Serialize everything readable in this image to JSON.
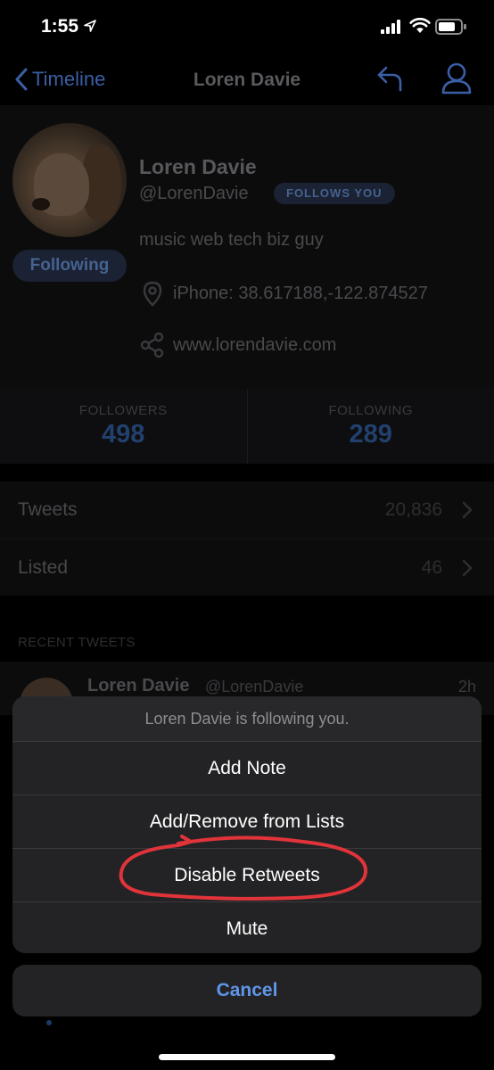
{
  "status_bar": {
    "time": "1:55"
  },
  "nav": {
    "back_label": "Timeline",
    "title": "Loren Davie"
  },
  "profile": {
    "name": "Loren Davie",
    "handle": "@LorenDavie",
    "follows_badge": "FOLLOWS YOU",
    "following_button": "Following",
    "bio": "music web tech biz guy",
    "location": "iPhone: 38.617188,-122.874527",
    "website": "www.lorendavie.com"
  },
  "stats": {
    "followers_label": "FOLLOWERS",
    "followers_count": "498",
    "following_label": "FOLLOWING",
    "following_count": "289"
  },
  "list": [
    {
      "label": "Tweets",
      "value": "20,836"
    },
    {
      "label": "Listed",
      "value": "46"
    }
  ],
  "recent_tweets": {
    "header": "RECENT TWEETS",
    "tweet": {
      "name": "Loren Davie",
      "handle": "@LorenDavie",
      "time": "2h"
    }
  },
  "action_sheet": {
    "message": "Loren Davie is following you.",
    "actions": [
      "Add Note",
      "Add/Remove from Lists",
      "Disable Retweets",
      "Mute"
    ],
    "cancel": "Cancel"
  },
  "colors": {
    "accent": "#5f96e8",
    "annotation": "#e0343a"
  }
}
